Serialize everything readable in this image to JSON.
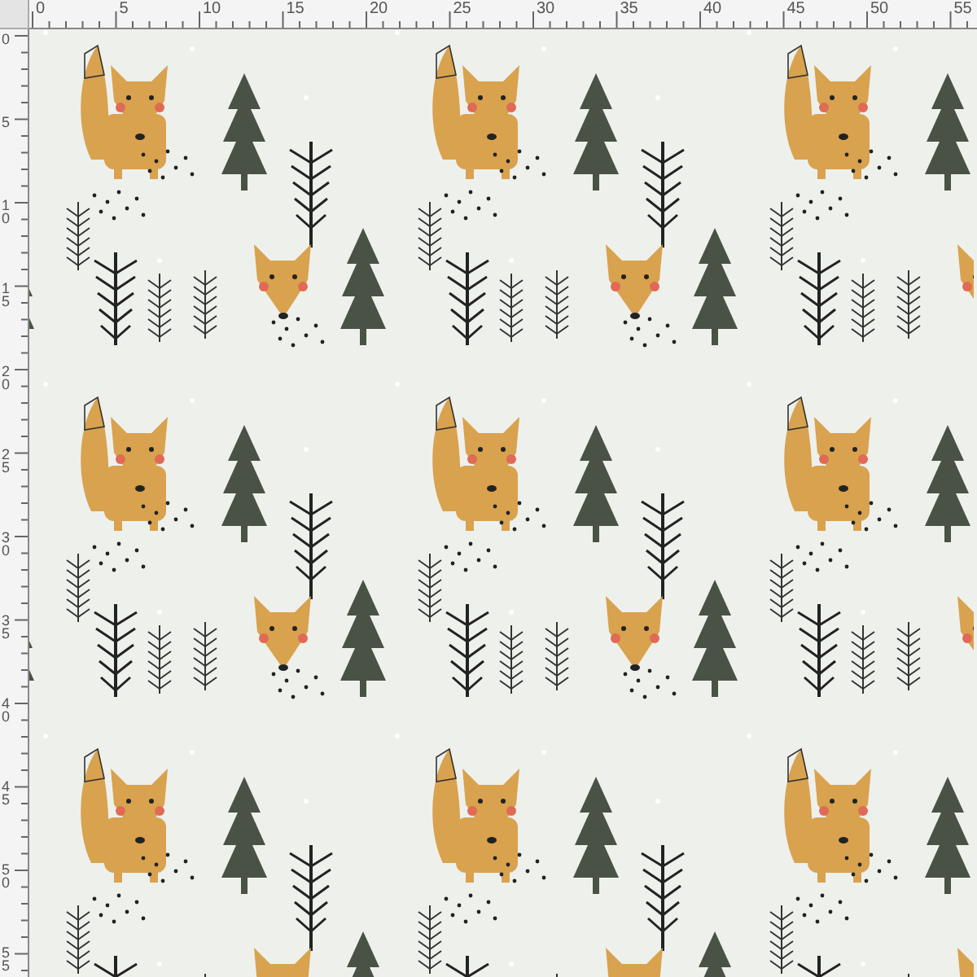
{
  "ruler_top": {
    "labels": [
      "0",
      "5",
      "10",
      "15",
      "20",
      "25",
      "30",
      "35",
      "40",
      "45",
      "50",
      "55"
    ]
  },
  "ruler_left": {
    "labels": [
      "0",
      "5",
      "10",
      "15",
      "20",
      "25",
      "30",
      "35",
      "40",
      "45",
      "50",
      "55"
    ]
  }
}
